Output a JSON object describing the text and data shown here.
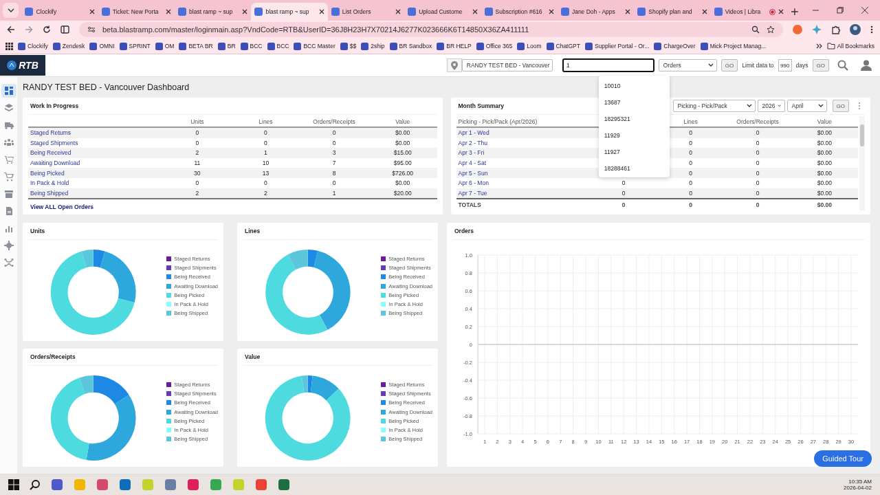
{
  "browser": {
    "tabs": [
      {
        "title": "Clockify",
        "selected": false
      },
      {
        "title": "Ticket: New Porta",
        "selected": false
      },
      {
        "title": "blast ramp ~ sup",
        "selected": false
      },
      {
        "title": "blast ramp ~ sup",
        "selected": true
      },
      {
        "title": "List Orders",
        "selected": false
      },
      {
        "title": "Upload Custome",
        "selected": false
      },
      {
        "title": "Subscription #616",
        "selected": false
      },
      {
        "title": "Jane Doh - Apps",
        "selected": false
      },
      {
        "title": "Shopify plan and",
        "selected": false
      },
      {
        "title": "Videos | Libra",
        "selected": false
      }
    ],
    "url": "beta.blastramp.com/master/loginmain.asp?VndCode=RTB&UserID=36J8H23H7X70214J6277K023666K6T14850X36ZA411111",
    "bookmarks": [
      "Clockify",
      "Zendesk",
      "OMNI",
      "SPRINT",
      "OM",
      "BETA BR",
      "BR",
      "BCC",
      "BCC",
      "BCC Master",
      "$$",
      "2ship",
      "BR Sandbox",
      "BR HELP",
      "Office 365",
      "Loom",
      "ChatGPT",
      "Supplier Portal - Or...",
      "ChargeOver",
      "Mick Project Manag..."
    ],
    "all_bookmarks": "All Bookmarks"
  },
  "header": {
    "logo": "RTB",
    "location": "RANDY TEST BED - Vancouver",
    "search_value": "1",
    "search_type": "Orders",
    "go": "GO",
    "limit_label": "Limit data to",
    "limit_days": "990",
    "days_label": "days",
    "go_limit": "GO"
  },
  "suggestions": [
    "10010",
    "13687",
    "18295321",
    "11929",
    "11927",
    "18288461"
  ],
  "sidebar": [
    {
      "kind": "dashboard",
      "selected": true
    },
    {
      "kind": "layers",
      "selected": false
    },
    {
      "kind": "truck",
      "selected": false
    },
    {
      "kind": "people",
      "selected": false
    },
    {
      "kind": "cart-in",
      "selected": false
    },
    {
      "kind": "cart",
      "selected": false
    },
    {
      "kind": "archive",
      "selected": false
    },
    {
      "kind": "document",
      "selected": false
    },
    {
      "kind": "bar-chart",
      "selected": false
    },
    {
      "kind": "gear",
      "selected": false
    },
    {
      "kind": "network",
      "selected": false
    }
  ],
  "page_title": "RANDY TEST BED - Vancouver Dashboard",
  "wip": {
    "title": "Work In Progress",
    "columns": [
      "Units",
      "Lines",
      "Orders/Receipts",
      "Value"
    ],
    "rows": [
      {
        "label": "Staged Returns",
        "units": "0",
        "lines": "0",
        "orders": "0",
        "value": "$0.00"
      },
      {
        "label": "Staged Shipments",
        "units": "0",
        "lines": "0",
        "orders": "0",
        "value": "$0.00"
      },
      {
        "label": "Being Received",
        "units": "2",
        "lines": "1",
        "orders": "3",
        "value": "$15.00"
      },
      {
        "label": "Awaiting Download",
        "units": "11",
        "lines": "10",
        "orders": "7",
        "value": "$95.00"
      },
      {
        "label": "Being Picked",
        "units": "30",
        "lines": "13",
        "orders": "8",
        "value": "$726.00"
      },
      {
        "label": "In Pack & Hold",
        "units": "0",
        "lines": "0",
        "orders": "0",
        "value": "$0.00"
      },
      {
        "label": "Being Shipped",
        "units": "2",
        "lines": "2",
        "orders": "1",
        "value": "$20.00"
      }
    ],
    "link": "View ALL Open Orders"
  },
  "month": {
    "title": "Month Summary",
    "filter": "Picking - Pick/Pack",
    "year": "2026",
    "month": "April",
    "go": "GO",
    "columns": [
      "Picking - Pick/Pack (Apr/2026)",
      "Lines",
      "Orders/Receipts",
      "Value"
    ],
    "rows": [
      {
        "label": "Apr 1 - Wed",
        "lines": "0",
        "orders": "0",
        "value": "$0.00"
      },
      {
        "label": "Apr 2 - Thu",
        "lines": "0",
        "orders": "0",
        "value": "$0.00"
      },
      {
        "label": "Apr 3 - Fri",
        "lines": "0",
        "orders": "0",
        "value": "$0.00"
      },
      {
        "label": "Apr 4 - Sat",
        "lines": "0",
        "orders": "0",
        "value": "$0.00"
      },
      {
        "label": "Apr 5 - Sun",
        "lines": "0",
        "orders": "0",
        "value": "$0.00"
      },
      {
        "label": "Apr 6 - Mon",
        "units": "0",
        "lines": "0",
        "orders": "0",
        "value": "$0.00"
      },
      {
        "label": "Apr 7 - Tue",
        "units": "0",
        "lines": "0",
        "orders": "0",
        "value": "$0.00"
      }
    ],
    "totals": {
      "label": "TOTALS",
      "units": "0",
      "lines": "0",
      "orders": "0",
      "value": "$0.00"
    }
  },
  "donuts": [
    {
      "slices": [
        {
          "color": "#6a1b9a"
        },
        {
          "color": "#673ab7"
        },
        {
          "color": "#1e88e5"
        },
        {
          "color": "#2ea7dc"
        },
        {
          "color": "#4ddbe0"
        },
        {
          "color": "#84ffff"
        },
        {
          "color": "#5bc6dc"
        }
      ],
      "chart_data": {
        "type": "donut",
        "legend": "right",
        "categories": [
          "Staged Returns",
          "Staged Shipments",
          "Being Received",
          "Awaiting Download",
          "Being Picked",
          "In Pack & Hold",
          "Being Shipped"
        ],
        "series": [
          {
            "name": "Units",
            "values": [
              0,
              0,
              4.4,
              24.5,
              66.7,
              0,
              4.4
            ]
          }
        ]
      }
    },
    {
      "slices": [
        {
          "color": "#6a1b9a"
        },
        {
          "color": "#673ab7"
        },
        {
          "color": "#1e88e5"
        },
        {
          "color": "#2ea7dc"
        },
        {
          "color": "#4ddbe0"
        },
        {
          "color": "#84ffff"
        },
        {
          "color": "#5bc6dc"
        }
      ],
      "chart_data": {
        "type": "donut",
        "legend": "right",
        "categories": [
          "Staged Returns",
          "Staged Shipments",
          "Being Received",
          "Awaiting Download",
          "Being Picked",
          "In Pack & Hold",
          "Being Shipped"
        ],
        "series": [
          {
            "name": "Lines",
            "values": [
              0,
              0,
              3.8,
              38.5,
              50.0,
              0,
              7.7
            ]
          }
        ]
      }
    },
    {
      "slices": [
        {
          "color": "#6a1b9a"
        },
        {
          "color": "#673ab7"
        },
        {
          "color": "#1e88e5"
        },
        {
          "color": "#2ea7dc"
        },
        {
          "color": "#4ddbe0"
        },
        {
          "color": "#84ffff"
        },
        {
          "color": "#5bc6dc"
        }
      ],
      "chart_data": {
        "type": "donut",
        "legend": "right",
        "categories": [
          "Staged Returns",
          "Staged Shipments",
          "Being Received",
          "Awaiting Download",
          "Being Picked",
          "In Pack & Hold",
          "Being Shipped"
        ],
        "series": [
          {
            "name": "Orders/Receipts",
            "values": [
              0,
              0,
              15.8,
              36.8,
              42.1,
              0,
              5.3
            ]
          }
        ]
      }
    },
    {
      "slices": [
        {
          "color": "#6a1b9a"
        },
        {
          "color": "#673ab7"
        },
        {
          "color": "#1e88e5"
        },
        {
          "color": "#2ea7dc"
        },
        {
          "color": "#4ddbe0"
        },
        {
          "color": "#84ffff"
        },
        {
          "color": "#5bc6dc"
        }
      ],
      "chart_data": {
        "type": "donut",
        "legend": "right",
        "categories": [
          "Staged Returns",
          "Staged Shipments",
          "Being Received",
          "Awaiting Download",
          "Being Picked",
          "In Pack & Hold",
          "Being Shipped"
        ],
        "series": [
          {
            "name": "Value",
            "values": [
              0,
              0,
              1.8,
              11.1,
              84.8,
              0,
              2.3
            ]
          }
        ]
      }
    }
  ],
  "orders_chart": {
    "chart_data": {
      "type": "line",
      "title": "Orders",
      "grid": true,
      "xlim": [
        1,
        30
      ],
      "ylim": [
        -1,
        1
      ],
      "yticks": [
        {
          "value": 1,
          "label": "1.0"
        },
        {
          "value": 0.8,
          "label": "0.8"
        },
        {
          "value": 0.6,
          "label": "0.6"
        },
        {
          "value": 0.4,
          "label": "0.4"
        },
        {
          "value": 0.2,
          "label": "0.2"
        },
        {
          "value": 0,
          "label": "0"
        },
        {
          "value": -0.2,
          "label": "-0.2"
        },
        {
          "value": -0.4,
          "label": "-0.4"
        },
        {
          "value": -0.6,
          "label": "-0.6"
        },
        {
          "value": -0.8,
          "label": "-0.8"
        },
        {
          "value": -1,
          "label": "-1.0"
        }
      ],
      "xticks": [
        1,
        2,
        3,
        4,
        5,
        6,
        7,
        8,
        9,
        10,
        11,
        12,
        13,
        14,
        15,
        16,
        17,
        18,
        19,
        20,
        21,
        22,
        23,
        24,
        25,
        26,
        27,
        28,
        29,
        30
      ]
    }
  },
  "guided_tour": "Guided Tour",
  "taskbar": {
    "time": "10:35 AM",
    "date": "2026-04-02"
  }
}
